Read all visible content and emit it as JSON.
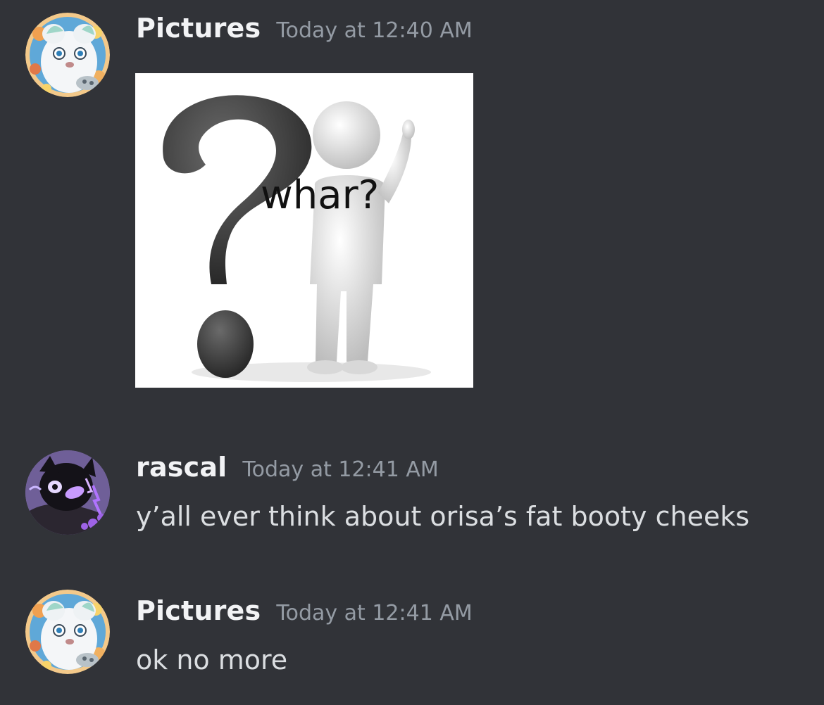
{
  "messages": [
    {
      "author": "Pictures",
      "timestamp": "Today at 12:40 AM",
      "avatar_icon": "white-furry-character-avatar",
      "attachment": {
        "type": "image",
        "icon": "question-mark-figure-meme",
        "caption_text": "whar?"
      }
    },
    {
      "author": "rascal",
      "timestamp": "Today at 12:41 AM",
      "avatar_icon": "dark-purple-character-avatar",
      "content": "y’all ever think about orisa’s fat booty cheeks"
    },
    {
      "author": "Pictures",
      "timestamp": "Today at 12:41 AM",
      "avatar_icon": "white-furry-character-avatar",
      "content": "ok no more"
    }
  ],
  "colors": {
    "background": "#313338",
    "username": "#f2f3f5",
    "timestamp": "#949ba4",
    "message_text": "#dbdee1"
  }
}
